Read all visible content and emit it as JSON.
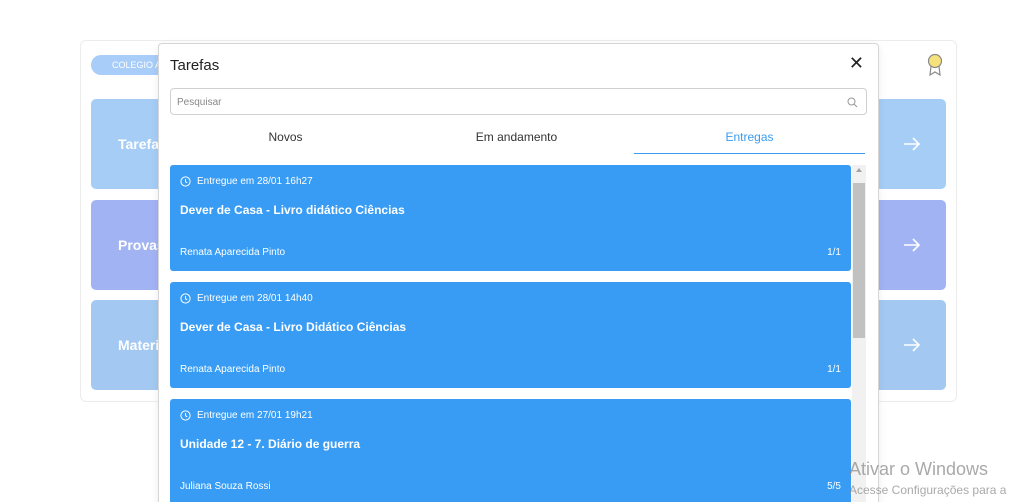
{
  "background": {
    "school_badge": "COLEGIO A",
    "tiles": [
      {
        "label": "Tarefa"
      },
      {
        "label": "Provas"
      },
      {
        "label": "Materi"
      }
    ]
  },
  "modal": {
    "title": "Tarefas",
    "close_icon": "close-icon",
    "search": {
      "placeholder": "Pesquisar",
      "value": ""
    },
    "tabs": [
      {
        "label": "Novos",
        "active": false
      },
      {
        "label": "Em andamento",
        "active": false
      },
      {
        "label": "Entregas",
        "active": true
      }
    ],
    "items": [
      {
        "date": "Entregue em 28/01 16h27",
        "title": "Dever de Casa - Livro didático Ciências",
        "teacher": "Renata Aparecida Pinto",
        "count": "1/1"
      },
      {
        "date": "Entregue em 28/01 14h40",
        "title": "Dever de Casa - Livro Didático Ciências",
        "teacher": "Renata Aparecida Pinto",
        "count": "1/1"
      },
      {
        "date": "Entregue em 27/01 19h21",
        "title": "Unidade 12 - 7. Diário de guerra",
        "teacher": "Juliana Souza Rossi",
        "count": "5/5"
      }
    ]
  },
  "watermark": {
    "line1": "Ativar o Windows",
    "line2": "Acesse Configurações para a"
  },
  "colors": {
    "accent": "#3a9cf0",
    "item_bg": "#389cf4"
  }
}
